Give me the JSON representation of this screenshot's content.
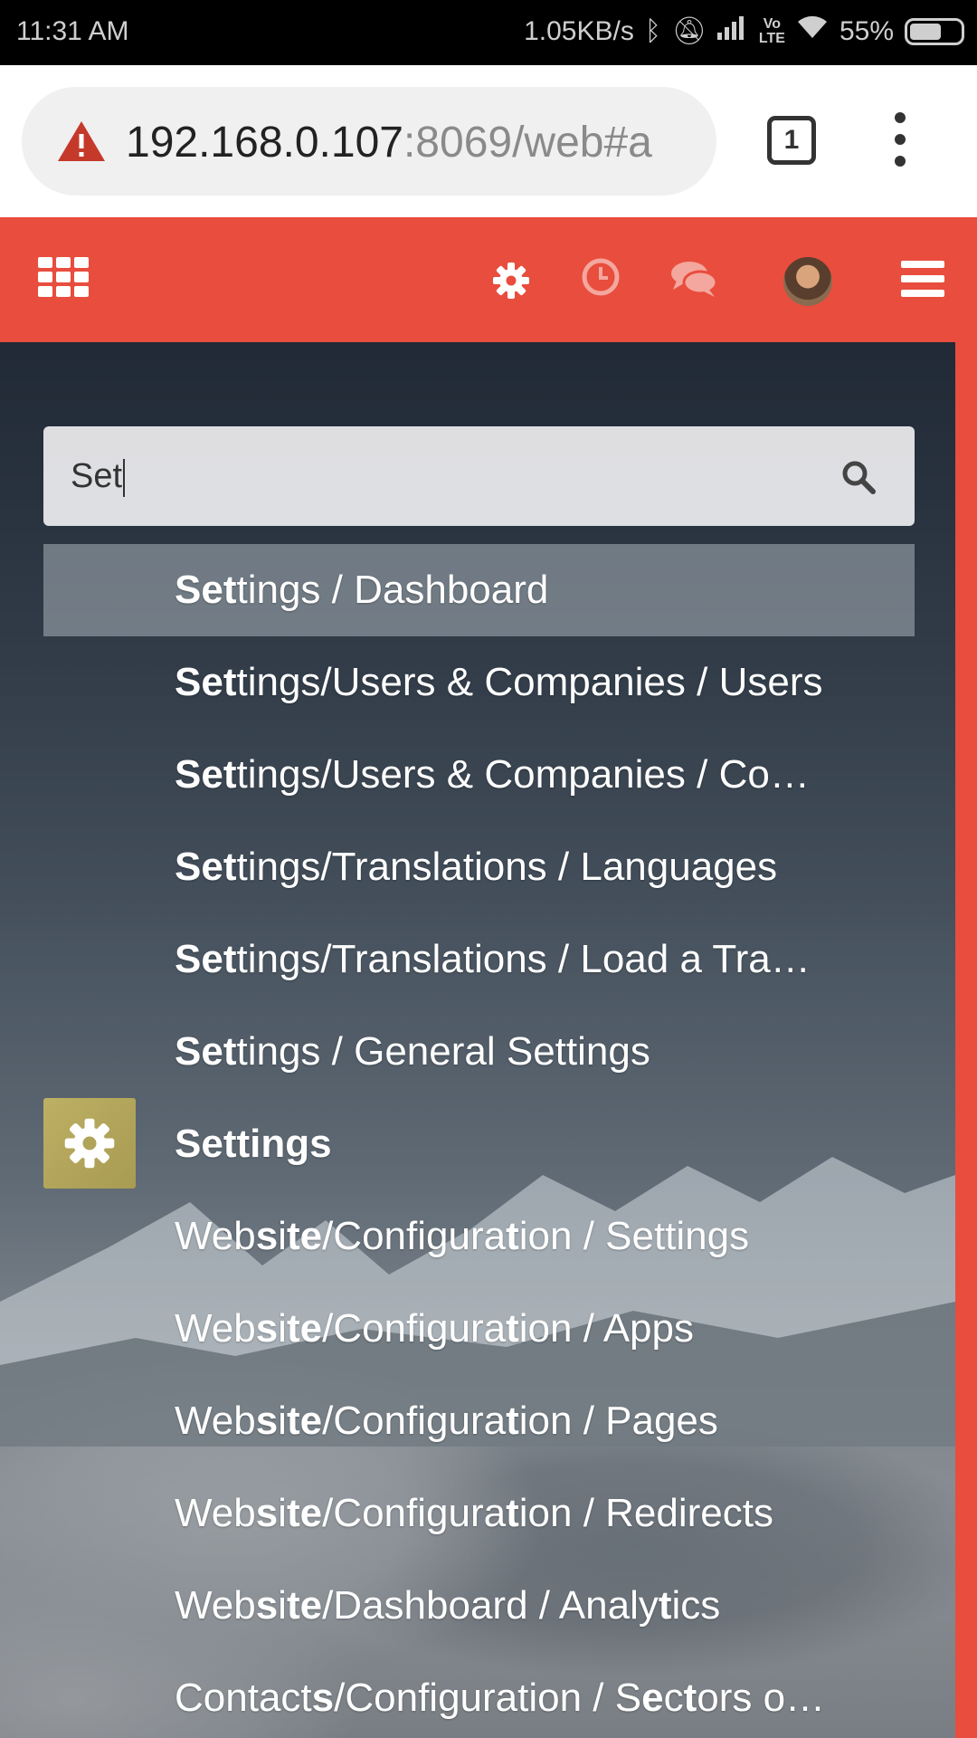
{
  "status_bar": {
    "time": "11:31 AM",
    "network_speed": "1.05KB/s",
    "battery": "55%"
  },
  "browser": {
    "url_host": "192.168.0.107",
    "url_rest": ":8069/web#a",
    "tab_count": "1"
  },
  "search": {
    "value": "Set"
  },
  "results": [
    {
      "segments": [
        {
          "t": "Set",
          "b": true
        },
        {
          "t": "tings / Dashboard",
          "b": false
        }
      ],
      "active": true,
      "icon": null
    },
    {
      "segments": [
        {
          "t": "Set",
          "b": true
        },
        {
          "t": "tings/Users & Companies / Users",
          "b": false
        }
      ],
      "active": false,
      "icon": null
    },
    {
      "segments": [
        {
          "t": "Set",
          "b": true
        },
        {
          "t": "tings/Users & Companies / Co…",
          "b": false
        }
      ],
      "active": false,
      "icon": null
    },
    {
      "segments": [
        {
          "t": "Set",
          "b": true
        },
        {
          "t": "tings/Translations / Languages",
          "b": false
        }
      ],
      "active": false,
      "icon": null
    },
    {
      "segments": [
        {
          "t": "Set",
          "b": true
        },
        {
          "t": "tings/Translations / Load a Tra…",
          "b": false
        }
      ],
      "active": false,
      "icon": null
    },
    {
      "segments": [
        {
          "t": "Set",
          "b": true
        },
        {
          "t": "tings / General Settings",
          "b": false
        }
      ],
      "active": false,
      "icon": null
    },
    {
      "segments": [
        {
          "t": "Settings",
          "b": true
        }
      ],
      "active": false,
      "icon": "gear-icon"
    },
    {
      "segments": [
        {
          "t": "Web",
          "b": false
        },
        {
          "t": "s",
          "b": true
        },
        {
          "t": "i",
          "b": false
        },
        {
          "t": "te",
          "b": true
        },
        {
          "t": "/Configura",
          "b": false
        },
        {
          "t": "t",
          "b": true
        },
        {
          "t": "ion / Settings",
          "b": false
        }
      ],
      "active": false,
      "icon": null
    },
    {
      "segments": [
        {
          "t": "Web",
          "b": false
        },
        {
          "t": "s",
          "b": true
        },
        {
          "t": "i",
          "b": false
        },
        {
          "t": "te",
          "b": true
        },
        {
          "t": "/Configura",
          "b": false
        },
        {
          "t": "t",
          "b": true
        },
        {
          "t": "ion / Apps",
          "b": false
        }
      ],
      "active": false,
      "icon": null
    },
    {
      "segments": [
        {
          "t": "Web",
          "b": false
        },
        {
          "t": "s",
          "b": true
        },
        {
          "t": "i",
          "b": false
        },
        {
          "t": "te",
          "b": true
        },
        {
          "t": "/Configura",
          "b": false
        },
        {
          "t": "t",
          "b": true
        },
        {
          "t": "ion / Pages",
          "b": false
        }
      ],
      "active": false,
      "icon": null
    },
    {
      "segments": [
        {
          "t": "Web",
          "b": false
        },
        {
          "t": "s",
          "b": true
        },
        {
          "t": "i",
          "b": false
        },
        {
          "t": "te",
          "b": true
        },
        {
          "t": "/Configura",
          "b": false
        },
        {
          "t": "t",
          "b": true
        },
        {
          "t": "ion / Redirects",
          "b": false
        }
      ],
      "active": false,
      "icon": null
    },
    {
      "segments": [
        {
          "t": "Web",
          "b": false
        },
        {
          "t": "s",
          "b": true
        },
        {
          "t": "i",
          "b": false
        },
        {
          "t": "te",
          "b": true
        },
        {
          "t": "/Dashboard / Analy",
          "b": false
        },
        {
          "t": "t",
          "b": true
        },
        {
          "t": "ics",
          "b": false
        }
      ],
      "active": false,
      "icon": null
    },
    {
      "segments": [
        {
          "t": "Contact",
          "b": false
        },
        {
          "t": "s",
          "b": true
        },
        {
          "t": "/Configuration / S",
          "b": false
        },
        {
          "t": "e",
          "b": true
        },
        {
          "t": "c",
          "b": false
        },
        {
          "t": "t",
          "b": true
        },
        {
          "t": "ors o…",
          "b": false
        }
      ],
      "active": false,
      "icon": null
    }
  ],
  "colors": {
    "header": "#e84d3d",
    "app_tile": "#b0a35a"
  }
}
